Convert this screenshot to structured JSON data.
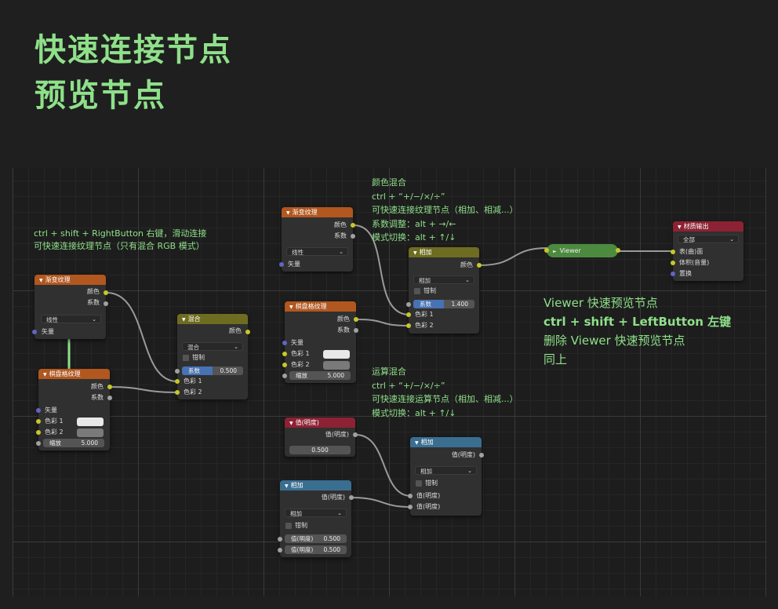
{
  "titles": {
    "line1": "快速连接节点",
    "line2": "预览节点"
  },
  "annotations": {
    "left": [
      "ctrl + shift + RightButton 右键，滑动连接",
      "可快速连接纹理节点（只有混合 RGB 模式）"
    ],
    "color_mix": [
      "颜色混合",
      "ctrl + “+/−/×/÷”",
      "可快速连接纹理节点（相加、相减...）",
      "系数调整：alt + →/←",
      "模式切换：alt + ↑/↓"
    ],
    "math_mix": [
      "运算混合",
      "ctrl + “+/−/×/÷”",
      "可快速连接运算节点（相加、相减...）",
      "模式切换：alt + ↑/↓"
    ],
    "viewer": [
      "Viewer 快速预览节点",
      "ctrl + shift + LeftButton 左键",
      "删除 Viewer 快速预览节点",
      "同上"
    ]
  },
  "nodes": {
    "grad1": {
      "title": "渐变纹理",
      "out_color": "颜色",
      "out_fac": "系数",
      "mode": "线性",
      "in_vector": "矢量"
    },
    "checker1": {
      "title": "棋盘格纹理",
      "out_color": "颜色",
      "out_fac": "系数",
      "in_vector": "矢量",
      "color1": "色彩 1",
      "color2": "色彩 2",
      "scale_label": "缩放",
      "scale_value": "5.000"
    },
    "mix1": {
      "title": "混合",
      "out_color": "颜色",
      "mode": "混合",
      "clamp": "钳制",
      "fac_label": "系数",
      "fac_value": "0.500",
      "fac": 0.5,
      "color1": "色彩 1",
      "color2": "色彩 2"
    },
    "grad2": {
      "title": "渐变纹理",
      "out_color": "颜色",
      "out_fac": "系数",
      "mode": "线性",
      "in_vector": "矢量"
    },
    "checker2": {
      "title": "棋盘格纹理",
      "out_color": "颜色",
      "out_fac": "系数",
      "in_vector": "矢量",
      "color1": "色彩 1",
      "color2": "色彩 2",
      "scale_label": "缩放",
      "scale_value": "5.000"
    },
    "add_color": {
      "title": "相加",
      "out_color": "颜色",
      "mode": "相加",
      "clamp": "钳制",
      "fac_label": "系数",
      "fac_value": "1.400",
      "fac": 0.5,
      "color1": "色彩 1",
      "color2": "色彩 2"
    },
    "viewer": {
      "title": "Viewer"
    },
    "output": {
      "title": "材质输出",
      "target": "全部",
      "in_surface": "表(曲)面",
      "in_volume": "体积(音量)",
      "in_disp": "置换"
    },
    "value": {
      "title": "值(明度)",
      "out": "值(明度)",
      "value": "0.500"
    },
    "math_add1": {
      "title": "相加",
      "out": "值(明度)",
      "mode": "相加",
      "clamp": "钳制",
      "in1": "值(明度)",
      "in2": "值(明度)"
    },
    "math_add2": {
      "title": "相加",
      "out": "值(明度)",
      "mode": "相加",
      "clamp": "钳制",
      "in1_label": "值(明度)",
      "in1_value": "0.500",
      "in2_label": "值(明度)",
      "in2_value": "0.500"
    }
  },
  "colors": {
    "accent_green": "#8fe08a",
    "header_texture": "#b1571f",
    "header_mix": "#6e6c20",
    "header_input": "#8c2233",
    "header_converter": "#3a6e91",
    "viewer_node": "#4c8a3f",
    "socket_color": "#c7c729",
    "socket_float": "#a1a1a1",
    "socket_vector": "#6363c7"
  }
}
